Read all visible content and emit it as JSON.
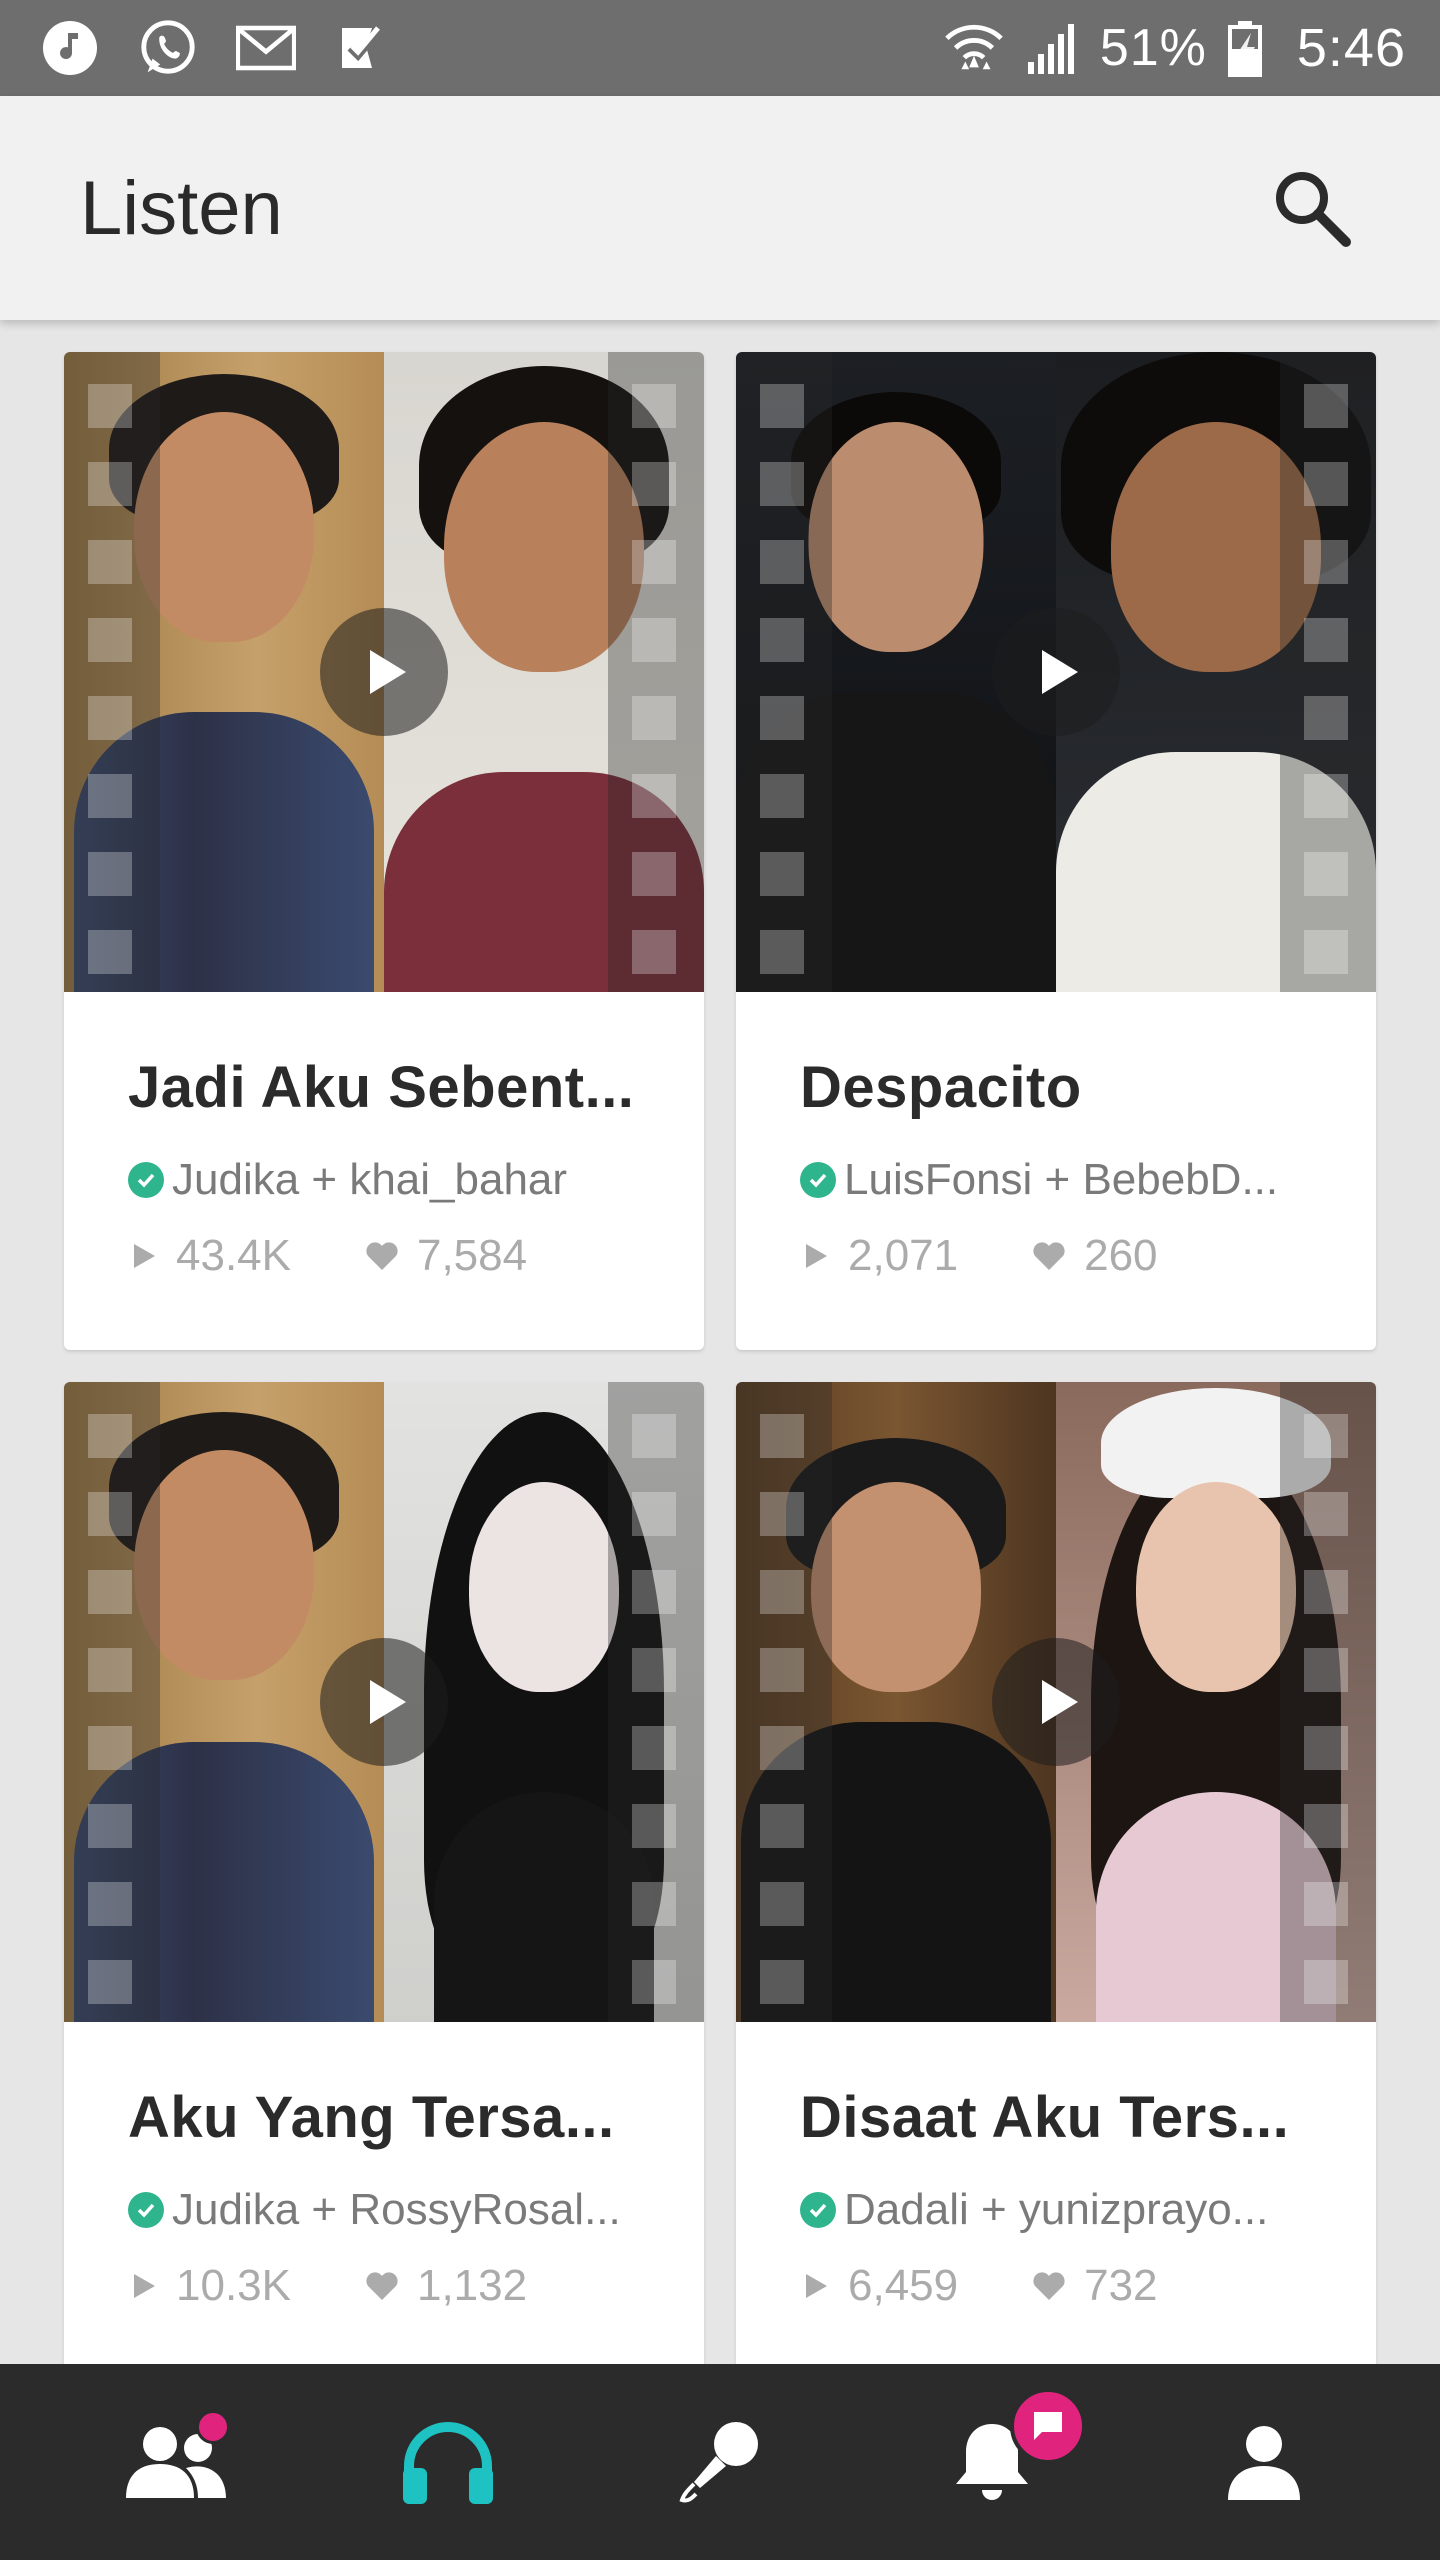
{
  "status_bar": {
    "icons_left": [
      "music-note-icon",
      "whatsapp-icon",
      "gmail-icon",
      "tasks-icon"
    ],
    "battery": "51%",
    "time": "5:46"
  },
  "app_bar": {
    "title": "Listen",
    "search_icon": "search-icon"
  },
  "cards": [
    {
      "title": "Jadi Aku Sebent...",
      "artists": "Judika + khai_bahar",
      "plays": "43.4K",
      "likes": "7,584"
    },
    {
      "title": "Despacito",
      "artists": "LuisFonsi + BebebD...",
      "plays": "2,071",
      "likes": "260"
    },
    {
      "title": "Aku Yang Tersa...",
      "artists": "Judika + RossyRosal...",
      "plays": "10.3K",
      "likes": "1,132"
    },
    {
      "title": "Disaat Aku Ters...",
      "artists": "Dadali + yunizprayo...",
      "plays": "6,459",
      "likes": "732"
    }
  ],
  "bottom_nav": {
    "items": [
      "people-icon",
      "headphones-icon",
      "microphone-icon",
      "bell-icon",
      "profile-icon"
    ],
    "active": "headphones-icon"
  },
  "colors": {
    "status_bar": "#6e6e6e",
    "app_bar": "#f1f1f1",
    "nav_bg": "#2b2b2b",
    "accent_teal": "#1fc2c2",
    "badge_pink": "#e0247d",
    "verified_green": "#2fb58d"
  }
}
